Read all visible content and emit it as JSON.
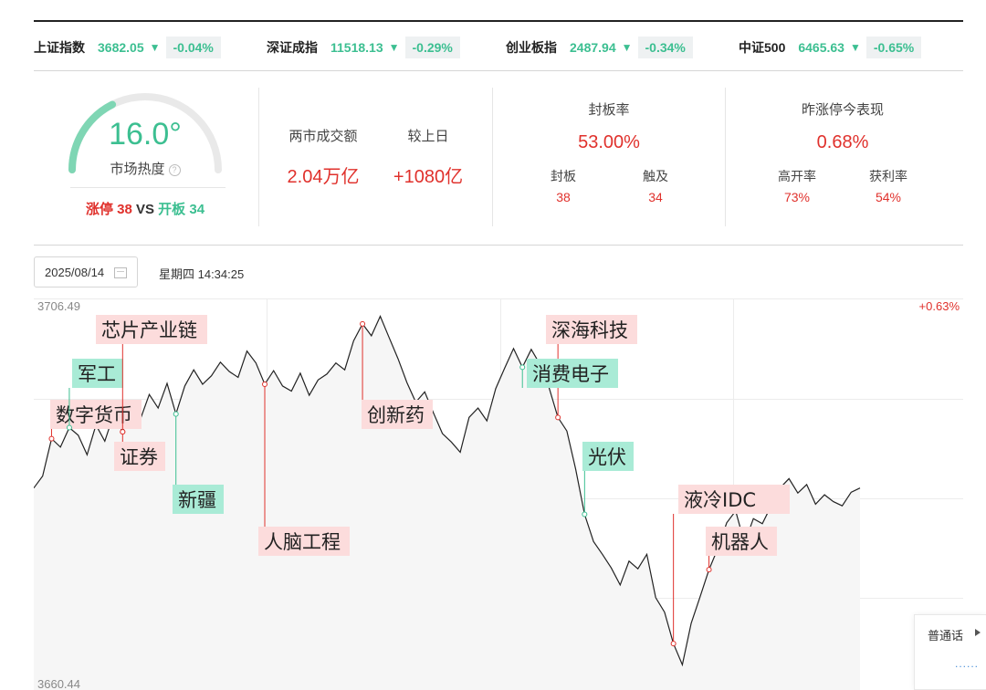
{
  "indices": [
    {
      "name": "上证指数",
      "value": "3682.05",
      "arrow": "▼",
      "change": "-0.04%"
    },
    {
      "name": "深证成指",
      "value": "11518.13",
      "arrow": "▼",
      "change": "-0.29%"
    },
    {
      "name": "创业板指",
      "value": "2487.94",
      "arrow": "▼",
      "change": "-0.34%"
    },
    {
      "name": "中证500",
      "value": "6465.63",
      "arrow": "▼",
      "change": "-0.65%"
    }
  ],
  "heat": {
    "value": "16.0°",
    "level_fraction": 0.16,
    "label": "市场热度",
    "help_icon": "?",
    "limit_up_label": "涨停",
    "limit_up": "38",
    "vs": "VS",
    "open_board_label": "开板",
    "open_board": "34"
  },
  "turnover": {
    "label": "两市成交额",
    "value": "2.04万亿",
    "compare_label": "较上日",
    "compare_value": "+1080亿"
  },
  "seal": {
    "label": "封板率",
    "value": "53.00%",
    "sealed_label": "封板",
    "sealed": "38",
    "touched_label": "触及",
    "touched": "34"
  },
  "yesterday": {
    "label": "昨涨停今表现",
    "value": "0.68%",
    "high_open_label": "高开率",
    "high_open": "73%",
    "profit_label": "获利率",
    "profit": "54%"
  },
  "date_picker": {
    "value": "2025/08/14",
    "icon": "calendar-icon"
  },
  "weekday_time": "星期四 14:34:25",
  "chart_data": {
    "type": "line",
    "y_max_label": "3706.49",
    "y_min_label": "3660.44",
    "right_top_label": "+0.63%",
    "ylim": [
      3660.44,
      3706.49
    ],
    "values": [
      3684.2,
      3685.6,
      3690.0,
      3689.0,
      3691.3,
      3690.4,
      3688.1,
      3691.6,
      3689.7,
      3692.9,
      3690.8,
      3694.2,
      3692.3,
      3695.2,
      3693.6,
      3696.5,
      3692.9,
      3696.2,
      3698.1,
      3696.4,
      3697.4,
      3699.0,
      3697.9,
      3697.2,
      3700.3,
      3698.9,
      3696.4,
      3698.0,
      3696.2,
      3695.6,
      3697.7,
      3695.1,
      3696.9,
      3697.6,
      3698.9,
      3698.1,
      3701.5,
      3703.5,
      3702.1,
      3704.4,
      3701.9,
      3699.4,
      3696.6,
      3694.3,
      3695.5,
      3693.0,
      3690.6,
      3689.6,
      3688.4,
      3692.5,
      3693.6,
      3692.1,
      3695.9,
      3698.3,
      3700.6,
      3698.4,
      3700.5,
      3698.7,
      3696.0,
      3692.5,
      3690.9,
      3686.4,
      3681.1,
      3677.9,
      3676.4,
      3674.8,
      3672.8,
      3675.6,
      3674.7,
      3676.4,
      3671.3,
      3669.6,
      3665.9,
      3663.4,
      3668.3,
      3671.4,
      3674.6,
      3677.1,
      3680.1,
      3681.5,
      3677.7,
      3680.6,
      3680.0,
      3682.1,
      3684.2,
      3685.3,
      3683.6,
      3684.6,
      3682.3,
      3683.4,
      3682.6,
      3682.1,
      3683.7,
      3684.2
    ],
    "series_color": "#222222",
    "tags": [
      {
        "label": "数字货币",
        "kind": "up",
        "idx": 2
      },
      {
        "label": "军工",
        "kind": "down",
        "idx": 4
      },
      {
        "label": "芯片产业链",
        "kind": "up",
        "idx": 10
      },
      {
        "label": "证券",
        "kind": "up",
        "idx": 10
      },
      {
        "label": "新疆",
        "kind": "down",
        "idx": 16
      },
      {
        "label": "人脑工程",
        "kind": "up",
        "idx": 26
      },
      {
        "label": "创新药",
        "kind": "up",
        "idx": 37
      },
      {
        "label": "深海科技",
        "kind": "up",
        "idx": 59
      },
      {
        "label": "消费电子",
        "kind": "down",
        "idx": 55
      },
      {
        "label": "光伏",
        "kind": "down",
        "idx": 62
      },
      {
        "label": "液冷IDC",
        "kind": "up",
        "idx": 72
      },
      {
        "label": "机器人",
        "kind": "up",
        "idx": 76
      }
    ]
  },
  "voice_widget": {
    "label": "普通话",
    "dots": "......"
  }
}
